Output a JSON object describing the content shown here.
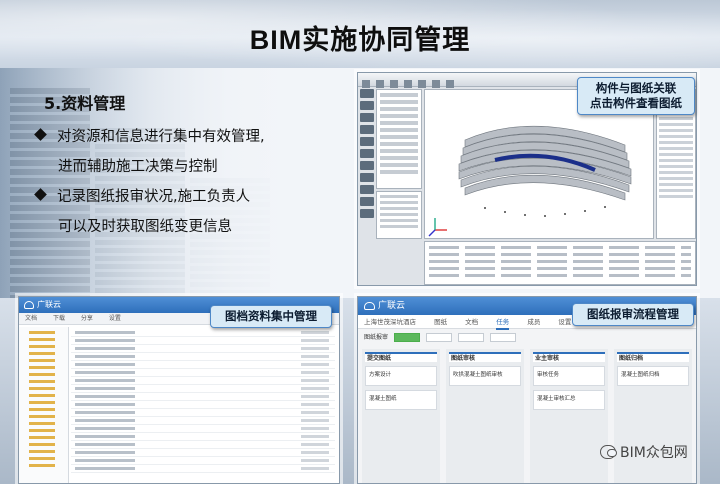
{
  "page": {
    "title": "BIM实施协同管理",
    "section_heading": "5.资料管理",
    "bullets": [
      {
        "line1": "对资源和信息进行集中有效管理,",
        "line2": "进而辅助施工决策与控制"
      },
      {
        "line1": "记录图纸报审状况,施工负责人",
        "line2": "可以及时获取图纸变更信息"
      }
    ]
  },
  "callouts": {
    "component_link": {
      "line1": "构件与图纸关联",
      "line2": "点击构件查看图纸"
    },
    "doc_management": "图档资料集中管理",
    "review_flow": "图纸报审流程管理"
  },
  "doc_window": {
    "app_name": "广联云",
    "tabs": [
      "文档",
      "下载",
      "分享",
      "设置"
    ]
  },
  "kanban_window": {
    "app_name": "广联云",
    "project": "上海世茂深坑酒店",
    "nav": [
      "图纸",
      "文档",
      "任务",
      "成员",
      "设置"
    ],
    "active_nav": "任务",
    "toolbar_label": "图纸报审",
    "columns": [
      {
        "title": "提交图纸",
        "cards": [
          "方案设计",
          "混凝土图纸"
        ]
      },
      {
        "title": "图纸审核",
        "cards": [
          "吹拱混凝土图纸审核"
        ]
      },
      {
        "title": "业主审核",
        "cards": [
          "审核任务",
          "混凝土审核汇总"
        ]
      },
      {
        "title": "图纸归档",
        "cards": [
          "混凝土图纸归档"
        ]
      }
    ]
  },
  "watermark": "BIM众包网",
  "colors": {
    "accent": "#2e6fbb",
    "callout_bg": "#d8eaf6",
    "callout_border": "#4e88c7"
  }
}
